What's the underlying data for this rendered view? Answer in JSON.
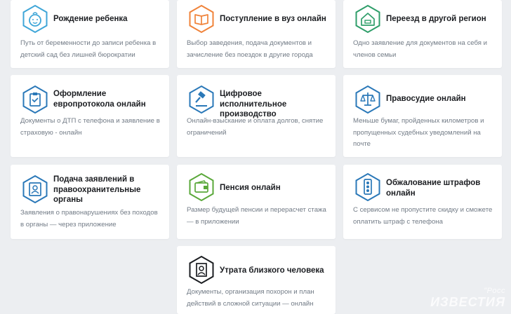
{
  "cards": [
    {
      "title": "Рождение ребенка",
      "description": "Путь от беременности до записи ребенка в детский сад без лишней бюрократии",
      "icon": "baby-icon",
      "color": "#3fa6d8"
    },
    {
      "title": "Поступление в вуз онлайн",
      "description": "Выбор заведения, подача документов и зачисление без поездок в другие города",
      "icon": "book-icon",
      "color": "#f0833a"
    },
    {
      "title": "Переезд в другой регион",
      "description": "Одно заявление для документов на себя и членов семьи",
      "icon": "house-icon",
      "color": "#2f9e6a"
    },
    {
      "title": "Оформление европротокола онлайн",
      "description": "Документы о ДТП с телефона и заявление в страховую - онлайн",
      "icon": "clipboard-icon",
      "color": "#2a78b8"
    },
    {
      "title": "Цифровое исполнительное производство",
      "description": "Онлайн-взыскание и оплата долгов, снятие ограничений",
      "icon": "gavel-icon",
      "color": "#2a78b8"
    },
    {
      "title": "Правосудие онлайн",
      "description": "Меньше бумаг, пройденных километров и пропущенных судебных уведомлений на почте",
      "icon": "scales-icon",
      "color": "#2a78b8"
    },
    {
      "title": "Подача заявлений в правоохранительные органы",
      "description": "Заявления о правонарушениях без походов в органы — через приложение",
      "icon": "id-badge-icon",
      "color": "#2a78b8"
    },
    {
      "title": "Пенсия онлайн",
      "description": "Размер будущей пенсии и перерасчет стажа — в приложении",
      "icon": "wallet-icon",
      "color": "#5aa83a"
    },
    {
      "title": "Обжалование штрафов онлайн",
      "description": "С сервисом не пропустите скидку и сможете оплатить штраф с телефона",
      "icon": "traffic-light-icon",
      "color": "#2a78b8"
    },
    {
      "title": "Утрата близкого человека",
      "description": "Документы, организация похорон и план действий в сложной ситуации — онлайн",
      "icon": "portrait-icon",
      "color": "#1b1d21"
    }
  ],
  "watermark": {
    "top": "\"Росс",
    "bottom": "ИЗВЕСТИЯ"
  }
}
